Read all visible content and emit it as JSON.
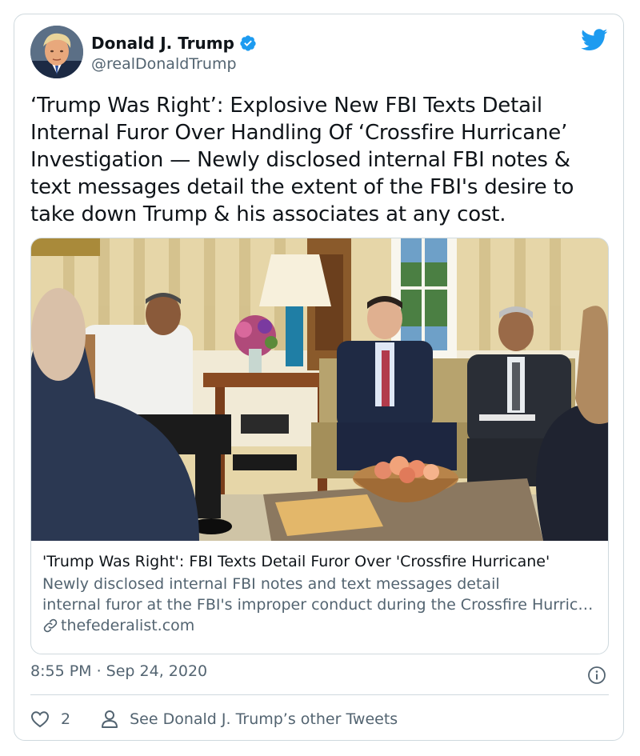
{
  "author": {
    "display_name": "Donald J. Trump",
    "handle": "@realDonaldTrump",
    "verified": true
  },
  "tweet": {
    "text": "‘Trump Was Right’: Explosive New FBI Texts Detail Internal Furor Over Handling Of ‘Crossfire Hurricane’ Investigation — Newly disclosed internal FBI notes & text messages detail the extent of the FBI's desire to take down Trump & his associates at any cost.",
    "timestamp": "8:55 PM · Sep 24, 2020"
  },
  "link_card": {
    "title": "'Trump Was Right': FBI Texts Detail Furor Over 'Crossfire Hurricane'",
    "description_line1": "Newly disclosed internal FBI notes and text messages detail",
    "description_line2": "internal furor at the FBI's improper conduct during the Crossfire Hurricane investigation.",
    "domain": "thefederalist.com"
  },
  "actions": {
    "like_count": "2",
    "profile_label": "See Donald J. Trump’s other Tweets"
  },
  "colors": {
    "brand_blue": "#1d9bf0",
    "text_primary": "#0f1419",
    "text_secondary": "#536471",
    "border": "#cfd9de"
  },
  "icons": [
    "verified-badge-icon",
    "twitter-bird-icon",
    "link-icon",
    "info-icon",
    "heart-icon",
    "person-icon"
  ]
}
